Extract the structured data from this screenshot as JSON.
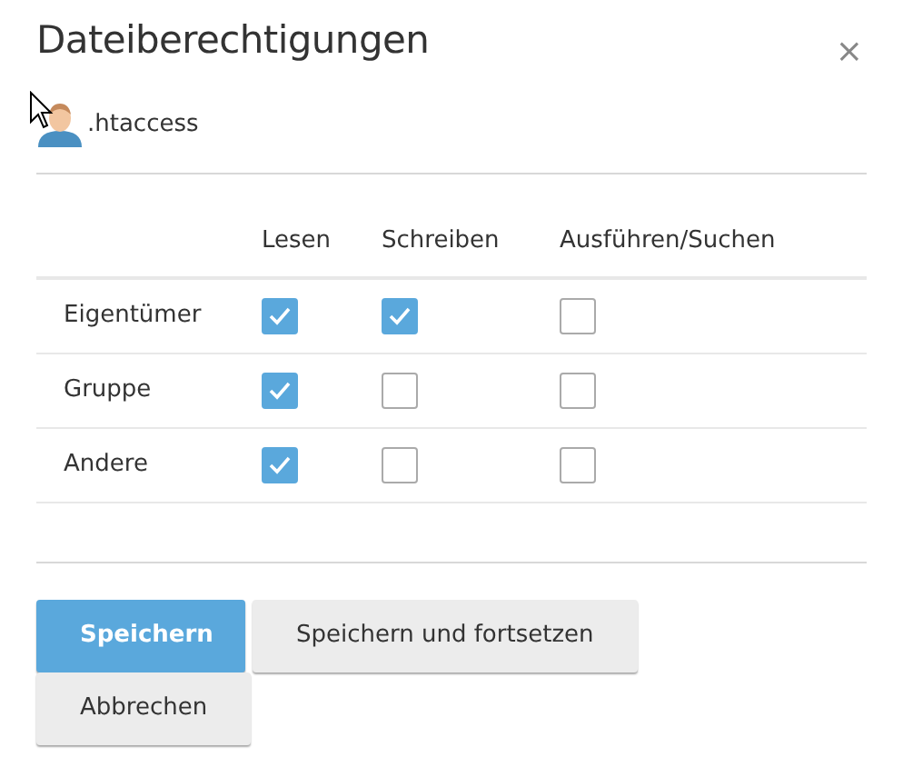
{
  "dialog": {
    "title": "Dateiberechtigungen",
    "close": "×",
    "file": ".htaccess"
  },
  "table": {
    "columns": [
      "Lesen",
      "Schreiben",
      "Ausführen/Suchen"
    ],
    "rows": [
      {
        "label": "Eigentümer",
        "checked": [
          true,
          true,
          false
        ]
      },
      {
        "label": "Gruppe",
        "checked": [
          true,
          false,
          false
        ]
      },
      {
        "label": "Andere",
        "checked": [
          true,
          false,
          false
        ]
      }
    ]
  },
  "buttons": [
    {
      "label": "Speichern",
      "kind": "primary"
    },
    {
      "label": "Speichern und fortsetzen",
      "kind": "default"
    },
    {
      "label": "Abbrechen",
      "kind": "default"
    }
  ]
}
